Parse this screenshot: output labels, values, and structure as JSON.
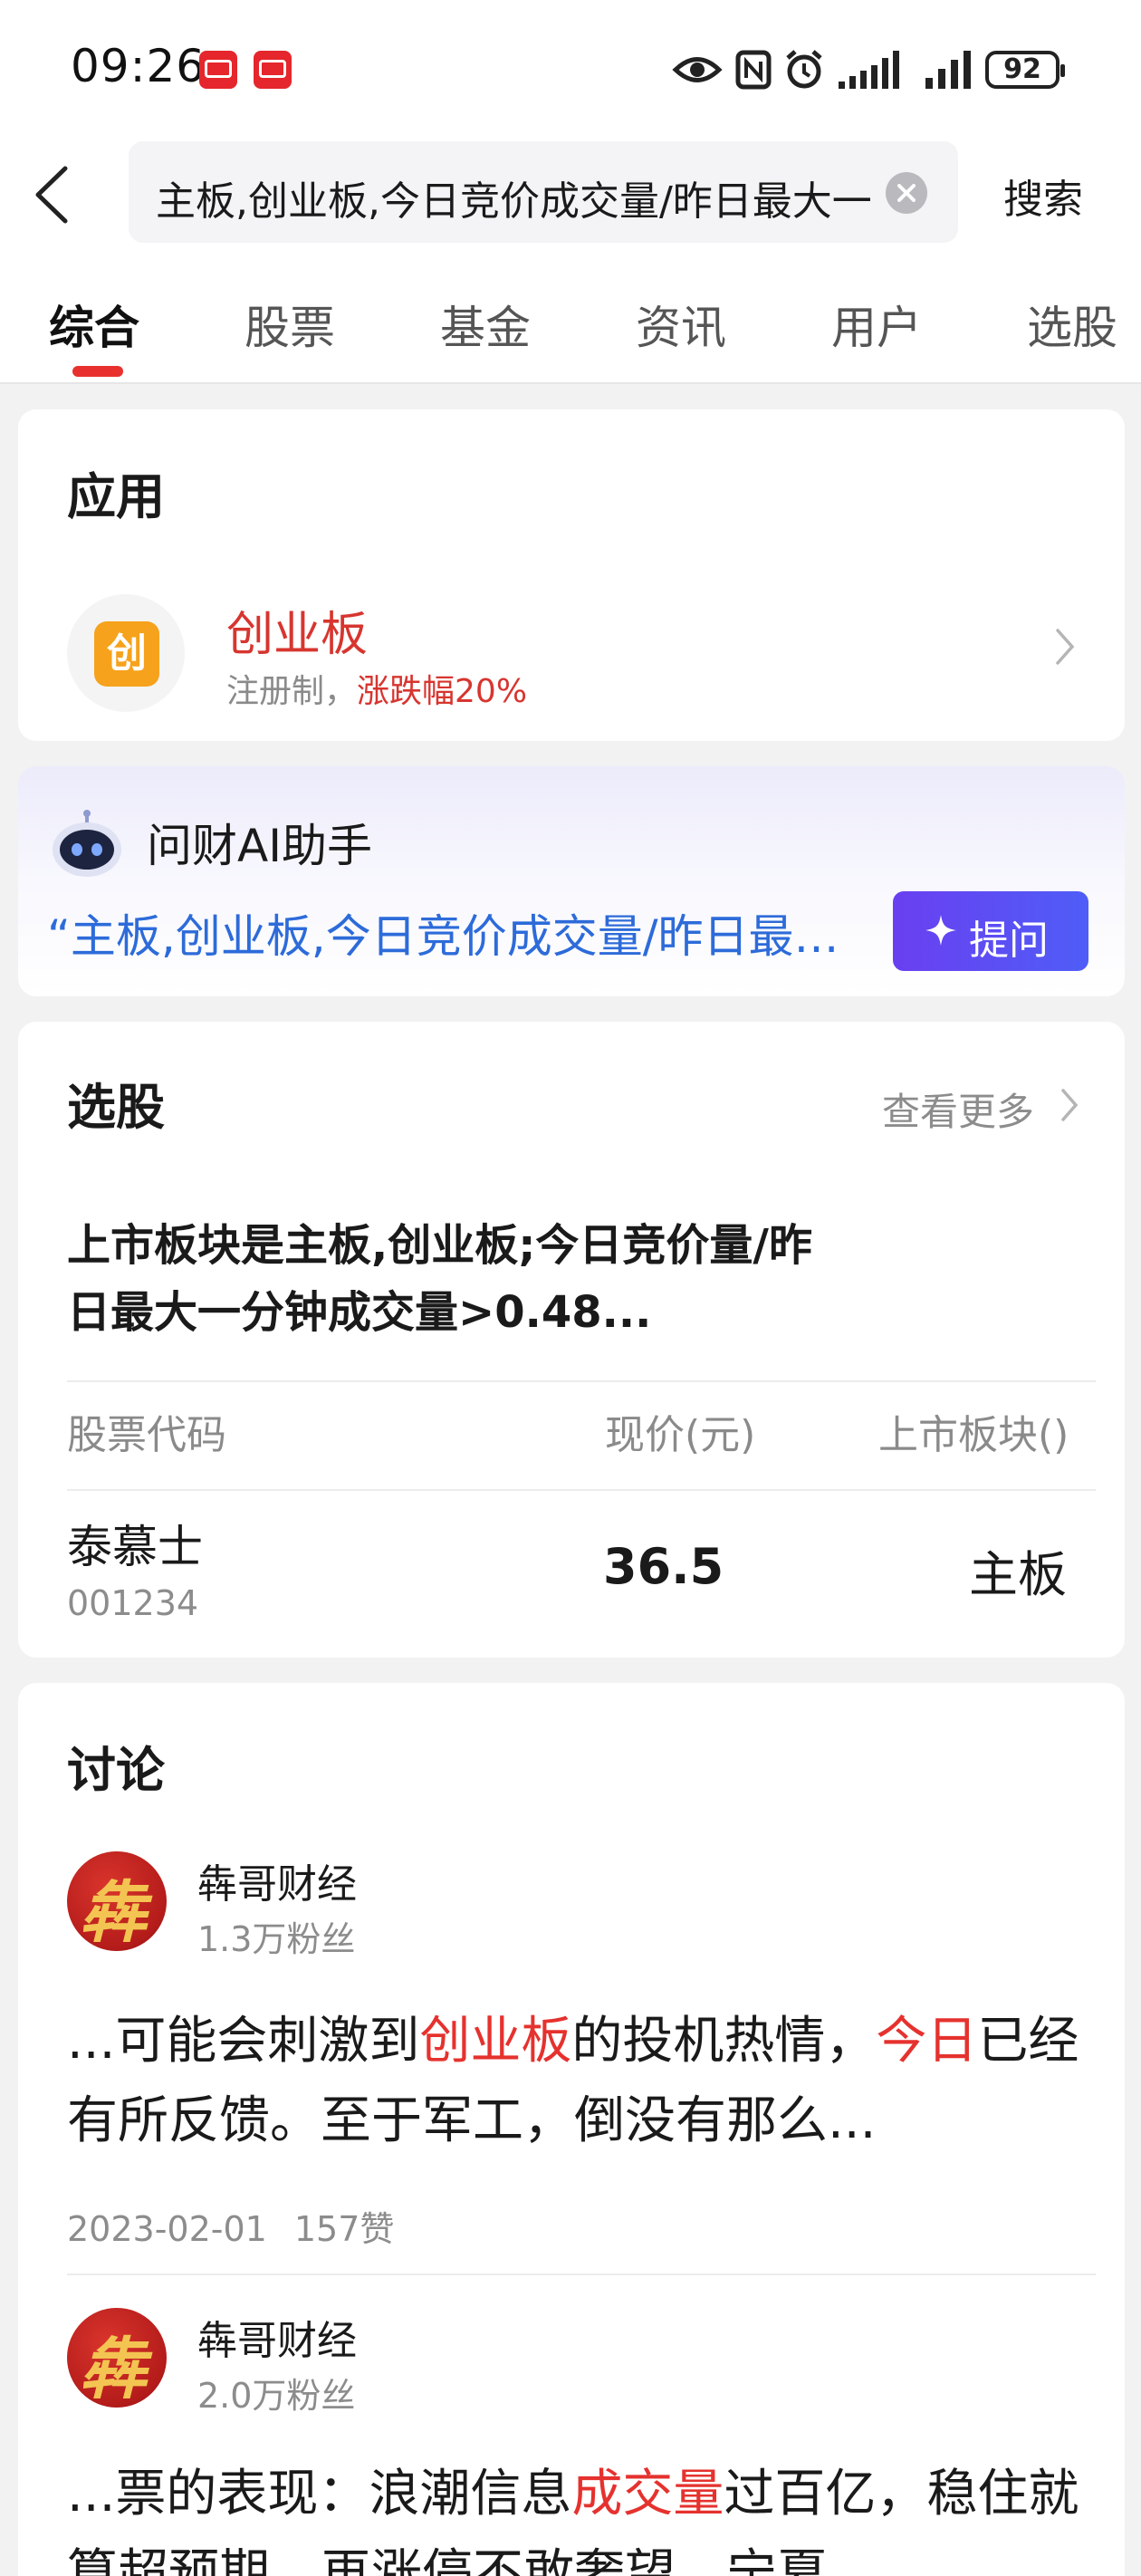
{
  "status_bar": {
    "time": "09:26",
    "battery": "92"
  },
  "search": {
    "back_label": "",
    "query": "主板,创业板,今日竞价成交量/昨日最大一分钟成交量",
    "submit_label": "搜索"
  },
  "tabs": [
    {
      "label": "综合",
      "active": true
    },
    {
      "label": "股票",
      "active": false
    },
    {
      "label": "基金",
      "active": false
    },
    {
      "label": "资讯",
      "active": false
    },
    {
      "label": "用户",
      "active": false
    },
    {
      "label": "选股",
      "active": false
    }
  ],
  "apps_section": {
    "title": "应用",
    "item": {
      "icon_glyph": "创",
      "name": "创业板",
      "desc_prefix": "注册制，",
      "desc_highlight": "涨跌幅20%"
    }
  },
  "ai": {
    "title": "问财AI助手",
    "quote": "“主板,创业板,今日竞价成交量/昨日最大一分钟成交量”",
    "ask_label": "提问"
  },
  "picker": {
    "title": "选股",
    "more_label": "查看更多",
    "condition": "上市板块是主板,创业板;今日竞价量/昨日最大一分钟成交量>0.48...",
    "headers": [
      "股票代码",
      "现价(元)",
      "上市板块()"
    ],
    "rows": [
      {
        "name": "泰慕士",
        "code": "001234",
        "price": "36.5",
        "board": "主板"
      }
    ]
  },
  "discussion": {
    "title": "讨论",
    "posts": [
      {
        "author": "犇哥财经",
        "fans": "1.3万粉丝",
        "t1": "...可能会刺激到",
        "h1": "创业板",
        "t2": "的投机热情，",
        "h2": "今日",
        "t3": "已经有所反馈。至于军工，倒没有那么...",
        "date": "2023-02-01",
        "likes": "157赞"
      },
      {
        "author": "犇哥财经",
        "fans": "2.0万粉丝",
        "t1": "...票的表现：浪潮信息",
        "h1": "成交量",
        "t2": "过百亿，稳住就算超预期，再涨停不敢奢望，宁夏..."
      }
    ]
  },
  "colors": {
    "accent_red": "#e5322e",
    "ai_blue": "#2d6bd9",
    "ask_button": "#5b4ff3"
  }
}
